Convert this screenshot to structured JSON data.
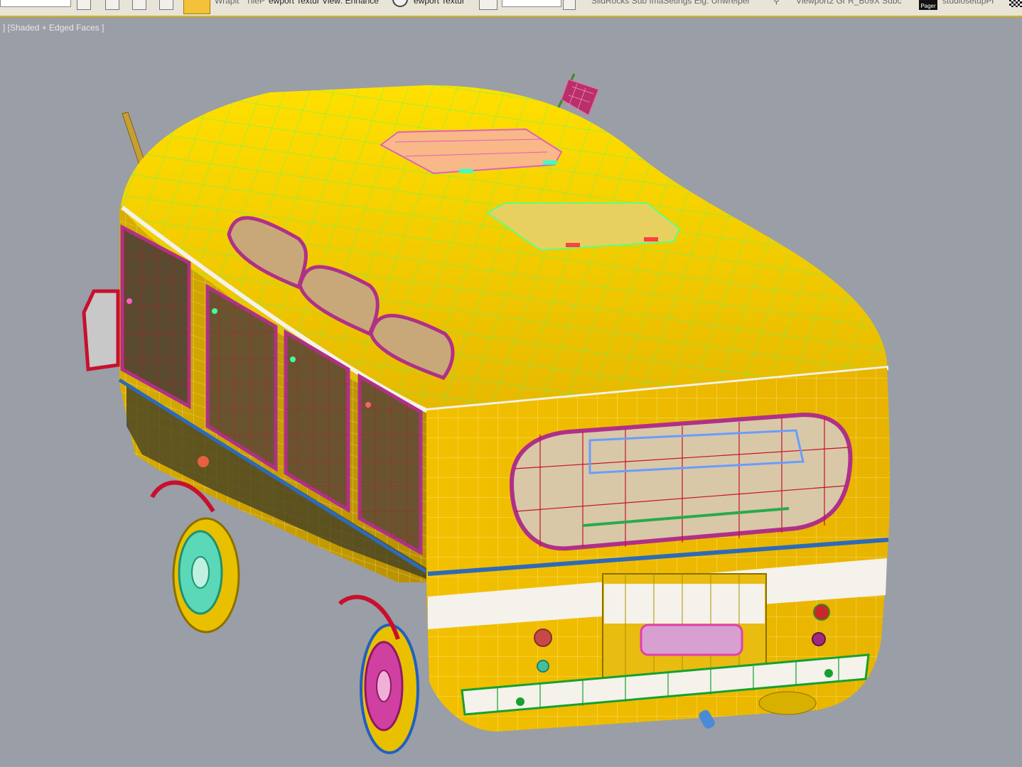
{
  "toolbar": {
    "wrapit_label": "Wrapit",
    "tile_label": "TileP",
    "texture_view_label": "ewport Textur View: Enhance",
    "viewport_texture_label": "ewport Textur",
    "subtools": "SlidRocks  Sub  ImaSetings  Elg: Unwreiper",
    "viewport2_label": "Viewport2  Gr R_B09X  Subc",
    "pager_label": "Pager",
    "studio_label": "studiosetupPr"
  },
  "viewport": {
    "label": "] [Shaded + Edged Faces ]"
  },
  "colors": {
    "background": "#9a9ea6",
    "body_yellow": "#f2c700",
    "wire_green": "#4cff7a",
    "wire_red": "#c8102e",
    "wire_magenta": "#c0379a",
    "stripe_blue": "#2d6ab8",
    "stripe_white": "#f4f2ea"
  }
}
